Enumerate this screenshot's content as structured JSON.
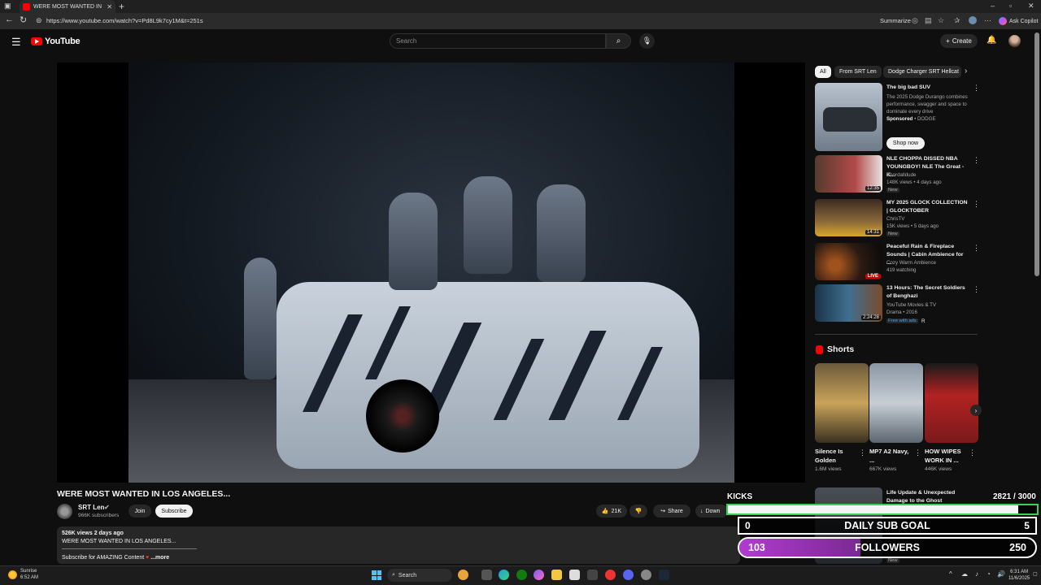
{
  "browser": {
    "tab_title": "WERE MOST WANTED IN LOS ANGELES...",
    "url": "https://www.youtube.com/watch?v=Pd8L9k7cy1M&t=251s",
    "summarize_label": "Summarize",
    "copilot_label": "Ask Copilot"
  },
  "header": {
    "logo_text": "YouTube",
    "search_placeholder": "Search",
    "create_label": "Create"
  },
  "video": {
    "title": "WERE MOST WANTED IN LOS ANGELES...",
    "channel_name": "SRT Len",
    "subscribers": "966K subscribers",
    "join_label": "Join",
    "subscribe_label": "Subscribe",
    "likes": "21K",
    "share_label": "Share",
    "download_label": "Down",
    "views_date": "526K views  2 days ago",
    "description_line": "WERE MOST WANTED IN LOS ANGELES...",
    "description_sub": "Subscribe for AMAZING Content",
    "more_label": "...more"
  },
  "chips": [
    "All",
    "From SRT Len",
    "Dodge Charger SRT Hellcat"
  ],
  "ad": {
    "title": "The big bad SUV",
    "desc": "The 2025 Dodge Durango combines performance, swagger and space to dominate every drive",
    "sponsored": "Sponsored",
    "advertiser": "DODGE",
    "cta": "Shop now"
  },
  "recommendations": [
    {
      "title": "NLE CHOPPA DISSED NBA YOUNGBOY! NLE The Great - K...",
      "channel": "Shordalldude",
      "meta": "148K views • 4 days ago",
      "badge": "New",
      "duration": "12:35"
    },
    {
      "title": "MY 2025 GLOCK COLLECTION | GLOCKTOBER",
      "channel": "ChrisTV",
      "meta": "15K views • 5 days ago",
      "badge": "New",
      "duration": "14:31"
    },
    {
      "title": "Peaceful Rain & Fireplace Sounds | Cabin Ambience for ...",
      "channel": "Cozy Warm Ambience",
      "meta": "419 watching",
      "badge": "",
      "duration": "LIVE"
    },
    {
      "title": "13 Hours: The Secret Soldiers of Benghazi",
      "channel": "YouTube Movies & TV",
      "meta": "Drama • 2016",
      "badge": "Free with ads",
      "rating": "R",
      "duration": "2:24:28"
    }
  ],
  "shorts": {
    "heading": "Shorts",
    "items": [
      {
        "title": "Silence Is Golden",
        "views": "1.6M views"
      },
      {
        "title": "MP7 A2 Navy, ...",
        "views": "667K views"
      },
      {
        "title": "HOW WIPES WORK IN ...",
        "views": "446K views"
      }
    ]
  },
  "partial_rec": {
    "title": "Life Update & Unexpected Damage to the Ghost",
    "badge": "New"
  },
  "overlay": {
    "kicks_label": "KICKS",
    "kicks_value": "2821",
    "kicks_goal": "/ 3000",
    "kicks_progress": 0.94,
    "daily_label": "DAILY SUB GOAL",
    "daily_current": "0",
    "daily_target": "5",
    "followers_label": "FOLLOWERS",
    "followers_current": "103",
    "followers_target": "250",
    "followers_progress": 0.41
  },
  "taskbar": {
    "weather_label": "Sunrise",
    "weather_time": "6:52 AM",
    "search_label": "Search",
    "time": "6:31 AM",
    "date": "11/6/2025"
  },
  "colors": {
    "yt_red": "#ff0000",
    "kicks_border": "#39d353",
    "followers_fill": "#b13bd1"
  }
}
